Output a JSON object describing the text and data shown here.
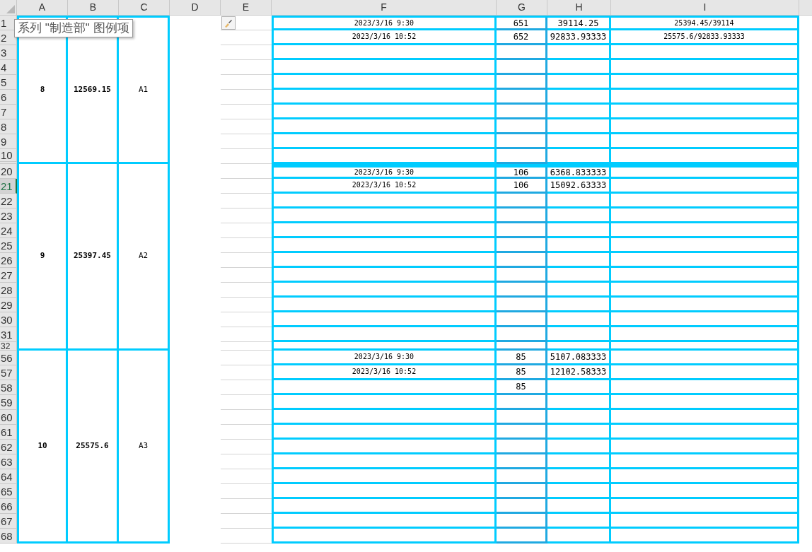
{
  "column_headers": [
    "A",
    "B",
    "C",
    "D",
    "E",
    "F",
    "G",
    "H",
    "I"
  ],
  "tooltip": {
    "text": "系列 \"制造部\" 图例项"
  },
  "groups": [
    {
      "a": "8",
      "b": "12569.15",
      "c": "A1",
      "rows": [
        {
          "number": "1",
          "selected": false,
          "kind": "normal",
          "f": "2023/3/16 9:30",
          "g": "651",
          "h": "39114.25",
          "i": "25394.45/39114"
        },
        {
          "number": "2",
          "selected": false,
          "kind": "normal",
          "f": "2023/3/16 10:52",
          "g": "652",
          "h": "92833.93333",
          "i": "25575.6/92833.93333"
        },
        {
          "number": "3",
          "selected": false,
          "kind": "normal"
        },
        {
          "number": "4",
          "selected": false,
          "kind": "normal"
        },
        {
          "number": "5",
          "selected": false,
          "kind": "normal"
        },
        {
          "number": "6",
          "selected": false,
          "kind": "normal"
        },
        {
          "number": "7",
          "selected": false,
          "kind": "normal"
        },
        {
          "number": "8",
          "selected": false,
          "kind": "normal"
        },
        {
          "number": "9",
          "selected": false,
          "kind": "normal"
        },
        {
          "number": "10",
          "selected": false,
          "kind": "normal"
        }
      ]
    },
    {
      "a": "9",
      "b": "25397.45",
      "c": "A2",
      "rows": [
        {
          "number": "20",
          "selected": false,
          "kind": "normal",
          "f": "2023/3/16 9:30",
          "g": "106",
          "h": "6368.833333"
        },
        {
          "number": "21",
          "selected": true,
          "kind": "normal",
          "f": "2023/3/16 10:52",
          "g": "106",
          "h": "15092.63333"
        },
        {
          "number": "22",
          "selected": false,
          "kind": "normal"
        },
        {
          "number": "23",
          "selected": false,
          "kind": "normal"
        },
        {
          "number": "24",
          "selected": false,
          "kind": "normal"
        },
        {
          "number": "25",
          "selected": false,
          "kind": "normal"
        },
        {
          "number": "26",
          "selected": false,
          "kind": "normal"
        },
        {
          "number": "27",
          "selected": false,
          "kind": "normal"
        },
        {
          "number": "28",
          "selected": false,
          "kind": "normal"
        },
        {
          "number": "29",
          "selected": false,
          "kind": "normal"
        },
        {
          "number": "30",
          "selected": false,
          "kind": "normal"
        },
        {
          "number": "31",
          "selected": false,
          "kind": "normal"
        },
        {
          "number": "32",
          "selected": false,
          "kind": "short"
        }
      ]
    },
    {
      "a": "10",
      "b": "25575.6",
      "c": "A3",
      "rows": [
        {
          "number": "56",
          "selected": false,
          "kind": "normal",
          "f": "2023/3/16 9:30",
          "g": "85",
          "h": "5107.083333"
        },
        {
          "number": "57",
          "selected": false,
          "kind": "normal",
          "f": "2023/3/16 10:52",
          "g": "85",
          "h": "12102.58333"
        },
        {
          "number": "58",
          "selected": false,
          "kind": "normal",
          "g": "85"
        },
        {
          "number": "59",
          "selected": false,
          "kind": "normal"
        },
        {
          "number": "60",
          "selected": false,
          "kind": "normal"
        },
        {
          "number": "61",
          "selected": false,
          "kind": "normal"
        },
        {
          "number": "62",
          "selected": false,
          "kind": "normal"
        },
        {
          "number": "63",
          "selected": false,
          "kind": "normal"
        },
        {
          "number": "64",
          "selected": false,
          "kind": "normal"
        },
        {
          "number": "65",
          "selected": false,
          "kind": "normal"
        },
        {
          "number": "66",
          "selected": false,
          "kind": "normal"
        },
        {
          "number": "67",
          "selected": false,
          "kind": "normal"
        },
        {
          "number": "68",
          "selected": false,
          "kind": "normal"
        }
      ]
    }
  ]
}
